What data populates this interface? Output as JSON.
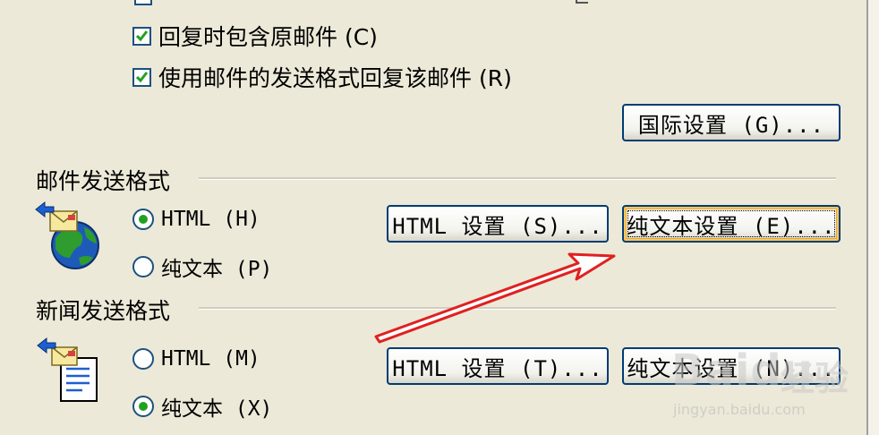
{
  "reply_options": {
    "include_original": "回复时包含原邮件 (C)",
    "reply_in_same_format": "使用邮件的发送格式回复该邮件 (R)",
    "international_button": "国际设置 (G)..."
  },
  "mail_format": {
    "title": "邮件发送格式",
    "html_option": "HTML (H)",
    "plaintext_option": "纯文本 (P)",
    "selected": "HTML",
    "html_settings_button": "HTML 设置 (S)...",
    "plaintext_settings_button": "纯文本设置 (E)..."
  },
  "news_format": {
    "title": "新闻发送格式",
    "html_option": "HTML (M)",
    "plaintext_option": "纯文本 (X)",
    "selected": "纯文本",
    "html_settings_button": "HTML 设置 (T)...",
    "plaintext_settings_button": "纯文本设置 (N)..."
  },
  "icons": {
    "mail_format_icon": "mail-globe-icon",
    "news_format_icon": "news-document-icon",
    "annotation": "red-arrow"
  },
  "colors": {
    "dialog_bg": "#ECE9D8",
    "button_border": "#003C74",
    "check_green": "#21A121",
    "annotation_red": "#E02020"
  },
  "watermark": {
    "logo": "Baidu",
    "cn": "经验",
    "url": "jingyan.baidu.com"
  }
}
